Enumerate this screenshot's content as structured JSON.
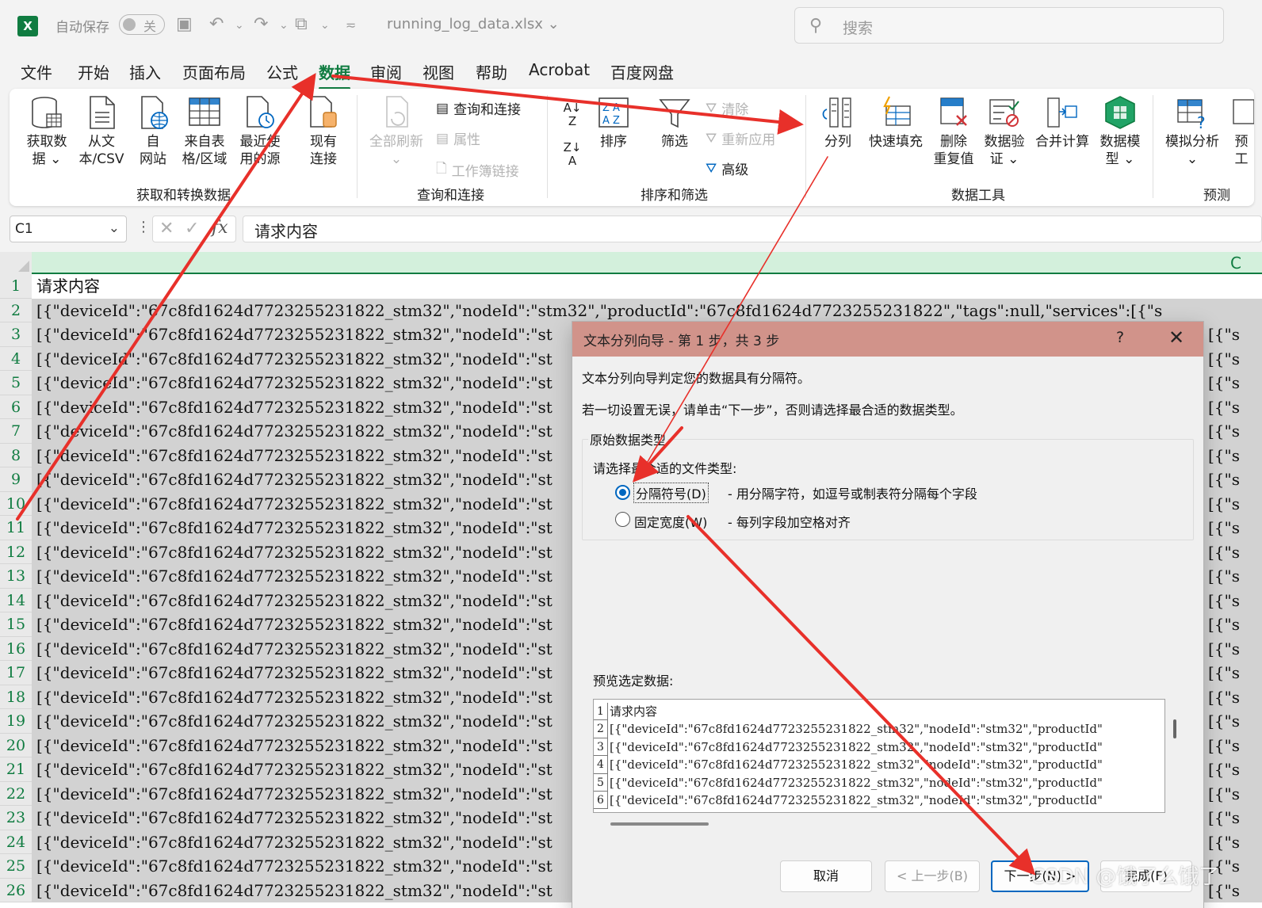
{
  "titlebar": {
    "app_icon": "excel-icon",
    "autosave_label": "自动保存",
    "autosave_state": "关",
    "filename": "running_log_data.xlsx",
    "search_placeholder": "搜索"
  },
  "menu": {
    "tabs": [
      "文件",
      "开始",
      "插入",
      "页面布局",
      "公式",
      "数据",
      "审阅",
      "视图",
      "帮助",
      "Acrobat",
      "百度网盘"
    ],
    "active": "数据"
  },
  "ribbon": {
    "get_transform": {
      "get_data": "获取数\n据 ⌄",
      "from_text_csv": "从文\n本/CSV",
      "from_web": "自\n网站",
      "from_table": "来自表\n格/区域",
      "recent_sources": "最近使\n用的源",
      "existing_connections": "现有\n连接",
      "label": "获取和转换数据"
    },
    "queries": {
      "refresh_all": "全部刷新",
      "queries_connections": "查询和连接",
      "properties": "属性",
      "edit_links": "工作簿链接",
      "label": "查询和连接"
    },
    "sort_filter": {
      "sort": "排序",
      "filter": "筛选",
      "clear": "清除",
      "reapply": "重新应用",
      "advanced": "高级",
      "label": "排序和筛选"
    },
    "data_tools": {
      "text_to_columns": "分列",
      "flash_fill": "快速填充",
      "remove_duplicates": "删除\n重复值",
      "data_validation": "数据验\n证 ⌄",
      "consolidate": "合并计算",
      "data_model": "数据模\n型 ⌄",
      "label": "数据工具"
    },
    "forecast": {
      "what_if": "模拟分析\n⌄",
      "forecast_sheet": "预\n工",
      "label": "预测"
    }
  },
  "formula_bar": {
    "name_box": "C1",
    "content": "请求内容"
  },
  "sheet": {
    "column_header": "C",
    "row_numbers": [
      "1",
      "2",
      "3",
      "4",
      "5",
      "6",
      "7",
      "8",
      "9",
      "10",
      "11",
      "12",
      "13",
      "14",
      "15",
      "16",
      "17",
      "18",
      "19",
      "20",
      "21",
      "22",
      "23",
      "24",
      "25",
      "26"
    ],
    "row1": "请求内容",
    "row2": "[{\"deviceId\":\"67c8fd1624d7723255231822_stm32\",\"nodeId\":\"stm32\",\"productId\":\"67c8fd1624d7723255231822\",\"tags\":null,\"services\":[{\"s",
    "row_data": "[{\"deviceId\":\"67c8fd1624d7723255231822_stm32\",\"nodeId\":\"st",
    "right_edge": "[{\"s"
  },
  "dialog": {
    "title": "文本分列向导 - 第 1 步，共 3 步",
    "help": "?",
    "close": "✕",
    "line1": "文本分列向导判定您的数据具有分隔符。",
    "line2": "若一切设置无误，请单击“下一步”，否则请选择最合适的数据类型。",
    "group_title": "原始数据类型",
    "prompt": "请选择最合适的文件类型:",
    "option_delimited": "分隔符号(D)",
    "option_delimited_desc": "- 用分隔字符，如逗号或制表符分隔每个字段",
    "option_fixed": "固定宽度(W)",
    "option_fixed_desc": "- 每列字段加空格对齐",
    "preview_label": "预览选定数据:",
    "preview_rows": [
      {
        "n": "1",
        "text": "请求内容"
      },
      {
        "n": "2",
        "text": "[{\"deviceId\":\"67c8fd1624d7723255231822_stm32\",\"nodeId\":\"stm32\",\"productId\""
      },
      {
        "n": "3",
        "text": "[{\"deviceId\":\"67c8fd1624d7723255231822_stm32\",\"nodeId\":\"stm32\",\"productId\""
      },
      {
        "n": "4",
        "text": "[{\"deviceId\":\"67c8fd1624d7723255231822_stm32\",\"nodeId\":\"stm32\",\"productId\""
      },
      {
        "n": "5",
        "text": "[{\"deviceId\":\"67c8fd1624d7723255231822_stm32\",\"nodeId\":\"stm32\",\"productId\""
      },
      {
        "n": "6",
        "text": "[{\"deviceId\":\"67c8fd1624d7723255231822_stm32\",\"nodeId\":\"stm32\",\"productId\""
      }
    ],
    "btn_cancel": "取消",
    "btn_back": "< 上一步(B)",
    "btn_next": "下一步(N) >",
    "btn_finish": "完成(F)"
  },
  "watermark": "CSDN @饿了么饿了",
  "colors": {
    "excel_green": "#107c41",
    "arrow_red": "#e8302a",
    "dialog_title": "#d1938a",
    "selection_gray": "#d2d2d2"
  }
}
